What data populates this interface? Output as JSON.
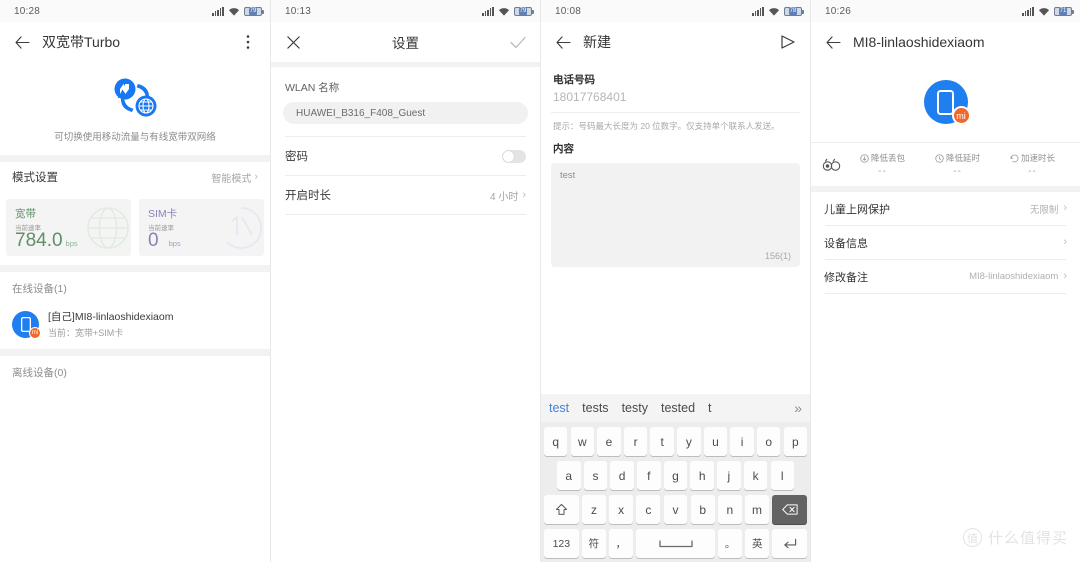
{
  "panels": [
    {
      "status": {
        "time": "10:28",
        "battery": "79"
      },
      "appbar": {
        "title": "双宽带Turbo"
      },
      "hero": {
        "caption": "可切换使用移动流量与有线宽带双网络"
      },
      "mode": {
        "label": "模式设置",
        "value": "智能模式"
      },
      "cards": [
        {
          "title": "宽带",
          "label": "当前速率",
          "value": "784.0",
          "unit": "bps"
        },
        {
          "title": "SIM卡",
          "label": "当前速率",
          "value": "0",
          "unit": "bps"
        }
      ],
      "online_label": "在线设备(1)",
      "device": {
        "name": "[自己]MI8-linlaoshidexiaom",
        "sub": "当前：宽带+SIM卡",
        "badge": "mi"
      },
      "offline_label": "离线设备(0)"
    },
    {
      "status": {
        "time": "10:13",
        "battery": "79"
      },
      "appbar": {
        "title": "设置"
      },
      "wlan": {
        "label": "WLAN 名称",
        "value": "HUAWEI_B316_F408_Guest"
      },
      "password": {
        "label": "密码",
        "state": "off"
      },
      "duration": {
        "label": "开启时长",
        "value": "4 小时"
      }
    },
    {
      "status": {
        "time": "10:08",
        "battery": "78"
      },
      "appbar": {
        "title": "新建"
      },
      "phone": {
        "label": "电话号码",
        "value": "18017768401"
      },
      "hint": "提示：号码最大长度为 20 位数字。仅支持单个联系人发送。",
      "content": {
        "label": "内容",
        "value": "test",
        "counter": "156(1)"
      },
      "keyboard": {
        "suggestions": [
          "test",
          "tests",
          "testy",
          "tested",
          "t"
        ],
        "active_suggestion": "test",
        "more": "»",
        "row1": [
          "q",
          "w",
          "e",
          "r",
          "t",
          "y",
          "u",
          "i",
          "o",
          "p"
        ],
        "row2": [
          "a",
          "s",
          "d",
          "f",
          "g",
          "h",
          "j",
          "k",
          "l"
        ],
        "row3": [
          "z",
          "x",
          "c",
          "v",
          "b",
          "n",
          "m"
        ],
        "shift": "shift-icon",
        "backspace": "backspace-icon",
        "row4": [
          "123",
          "符",
          "，",
          "space",
          "。",
          "英",
          "enter"
        ]
      }
    },
    {
      "status": {
        "time": "10:26",
        "battery": "71"
      },
      "appbar": {
        "title": "MI8-linlaoshidexiaom"
      },
      "avatar_badge": "mi",
      "metrics": [
        {
          "title": "降低丢包",
          "value": "--"
        },
        {
          "title": "降低延时",
          "value": "--"
        },
        {
          "title": "加速时长",
          "value": "--"
        }
      ],
      "rows": [
        {
          "label": "儿童上网保护",
          "value": "无限制"
        },
        {
          "label": "设备信息",
          "value": ""
        },
        {
          "label": "修改备注",
          "value": "MI8-linlaoshidexiaom"
        }
      ]
    }
  ],
  "watermark": {
    "mark": "值",
    "text": "什么值得买"
  }
}
